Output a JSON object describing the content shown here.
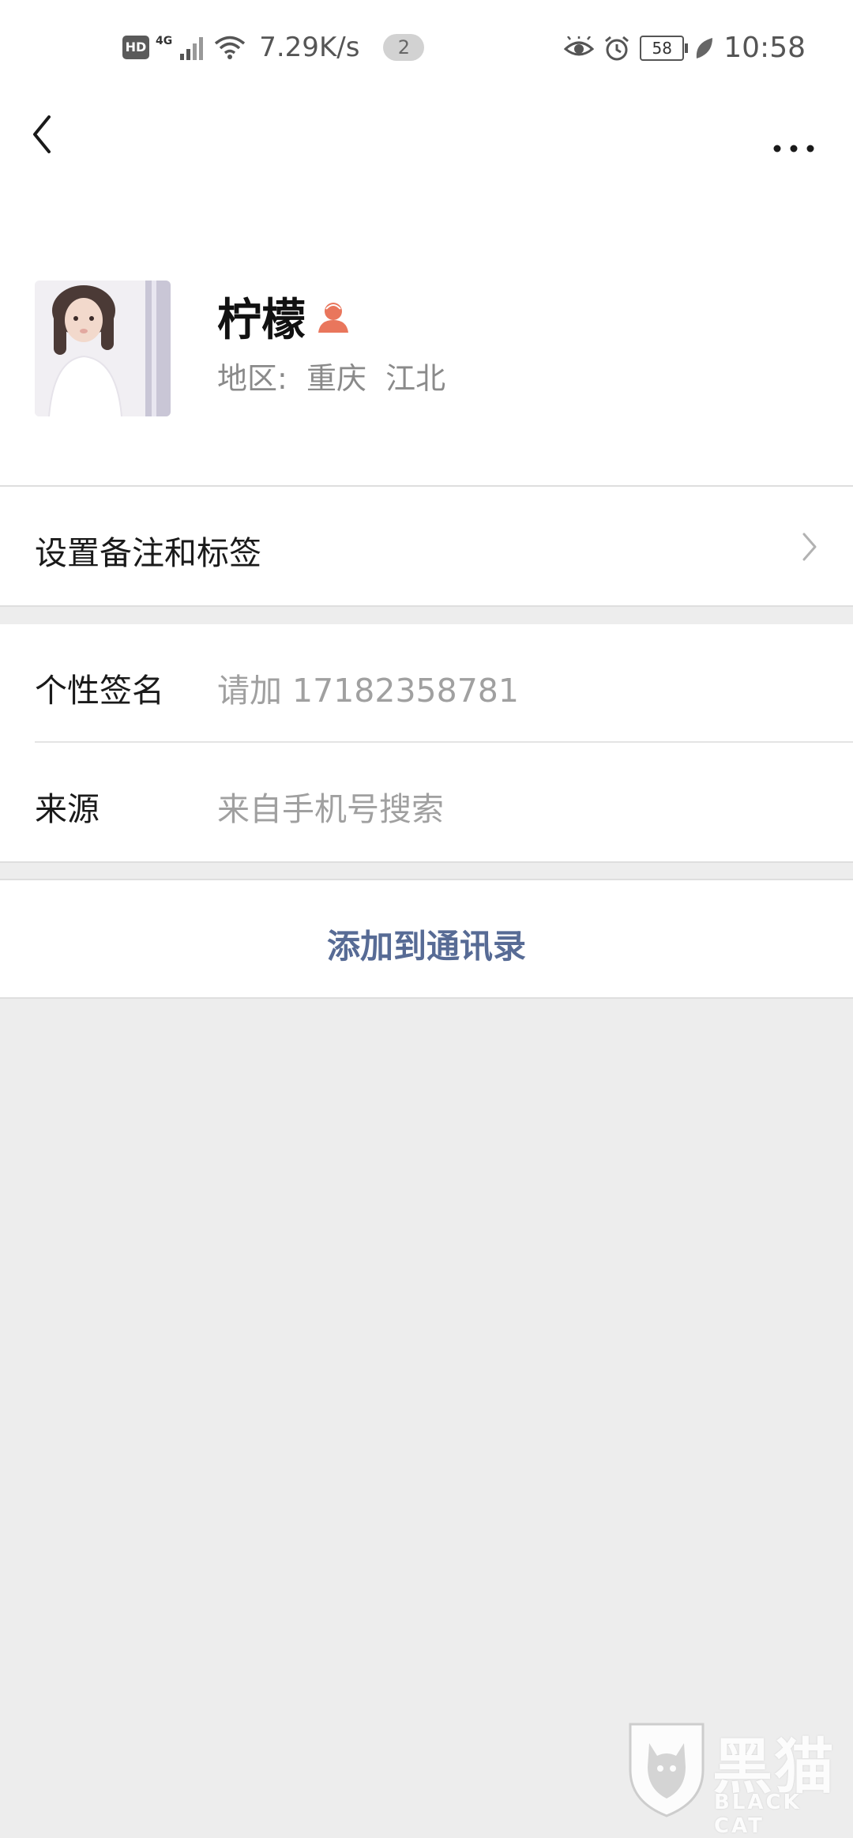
{
  "status_bar": {
    "hd_label": "HD",
    "network_label": "4G",
    "net_speed": "7.29K/s",
    "notification_count": "2",
    "battery_level": "58",
    "time": "10:58"
  },
  "profile": {
    "name": "柠檬",
    "region": "地区:  重庆  江北",
    "gender_icon": "female-icon"
  },
  "rows": {
    "remark_label": "设置备注和标签",
    "signature_label": "个性签名",
    "signature_value": "请加 17182358781",
    "source_label": "来源",
    "source_value": "来自手机号搜索"
  },
  "actions": {
    "add_contact_label": "添加到通讯录"
  },
  "watermark": {
    "cn": "黑猫",
    "en": "BLACK CAT"
  },
  "colors": {
    "accent_link": "#576b95",
    "gender_icon": "#e9765c",
    "background": "#ededed"
  }
}
